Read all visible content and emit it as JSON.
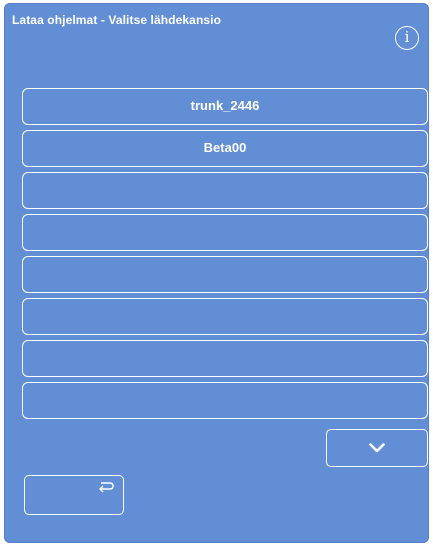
{
  "header": {
    "title": "Lataa ohjelmat - Valitse lähdekansio",
    "info_icon": "info-icon"
  },
  "folders": [
    {
      "label": "trunk_2446"
    },
    {
      "label": "Beta00"
    },
    {
      "label": ""
    },
    {
      "label": ""
    },
    {
      "label": ""
    },
    {
      "label": ""
    },
    {
      "label": ""
    },
    {
      "label": ""
    }
  ],
  "navigation": {
    "scroll_down_icon": "chevron-down-icon",
    "back_icon": "return-arrow-icon"
  },
  "colors": {
    "background": "#628ed6",
    "foreground": "#ffffff"
  }
}
